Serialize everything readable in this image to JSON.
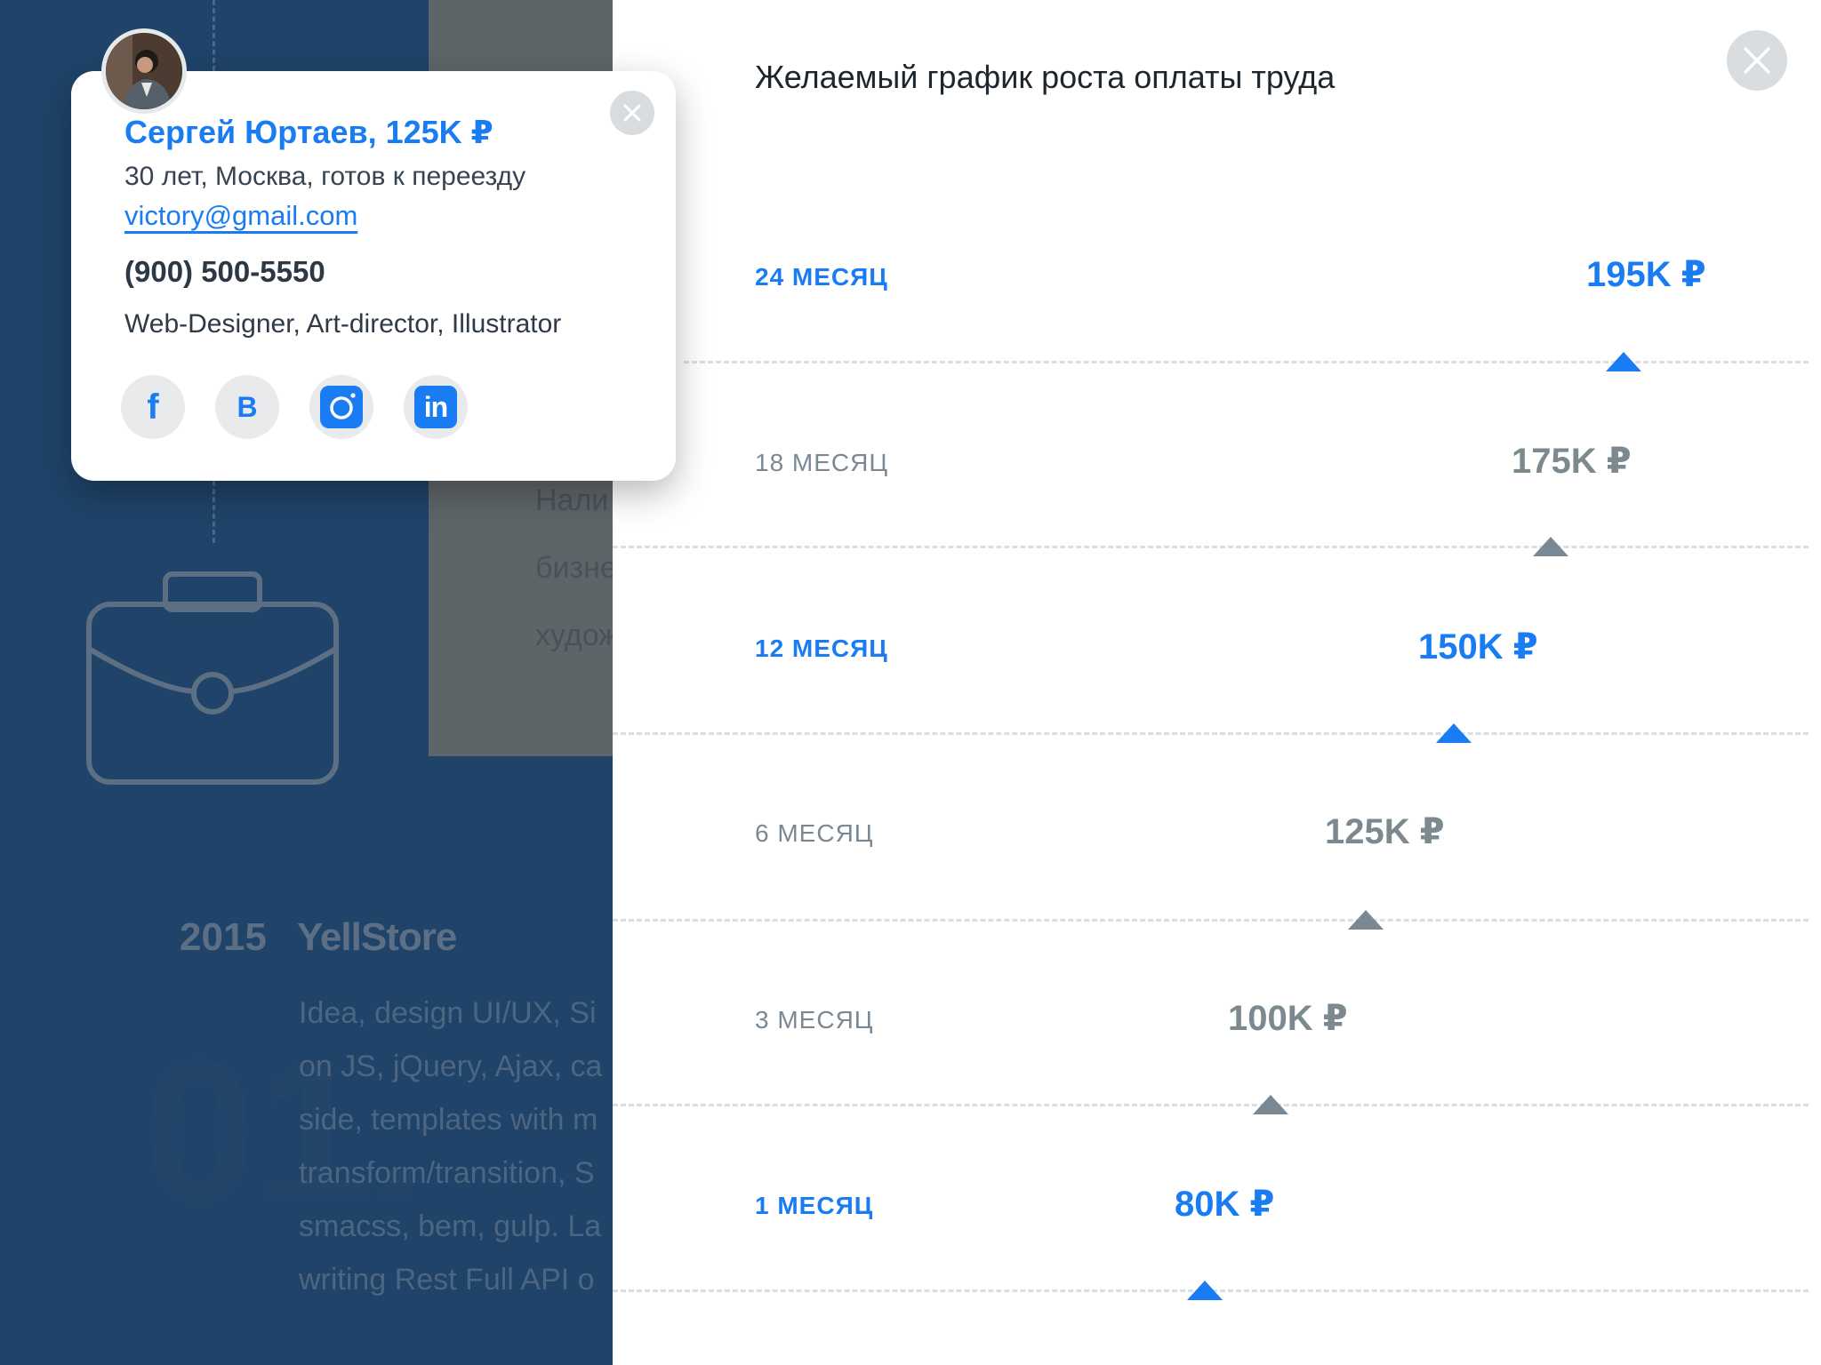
{
  "background": {
    "card_lines": [
      "Нали",
      "бизне",
      "худож"
    ],
    "year": "2015",
    "company": "YellStore",
    "ghost_text": "01.",
    "description_lines": [
      "Idea, design UI/UX, Si",
      "on JS, jQuery, Ajax, ca",
      "side, templates with m",
      "transform/transition, S",
      "smacss, bem, gulp. La",
      "writing Rest Full API o"
    ]
  },
  "contact": {
    "name_line": "Сергей Юртаев, 125K ₽",
    "info": "30 лет, Москва, готов к переезду",
    "email": "victory@gmail.com",
    "phone": "(900) 500-5550",
    "roles": "Web-Designer, Art-director, Illustrator",
    "socials": [
      {
        "name": "facebook",
        "glyph": "f"
      },
      {
        "name": "vk",
        "glyph": "B"
      },
      {
        "name": "instagram"
      },
      {
        "name": "linkedin",
        "glyph": "in"
      }
    ]
  },
  "salary_panel": {
    "title": "Желаемый график роста оплаты труда",
    "milestones": [
      {
        "label": "24 МЕСЯЦ",
        "amount": "195K ₽",
        "highlight": true
      },
      {
        "label": "18 МЕСЯЦ",
        "amount": "175K ₽",
        "highlight": false
      },
      {
        "label": "12 МЕСЯЦ",
        "amount": "150K ₽",
        "highlight": true
      },
      {
        "label": "6 МЕСЯЦ",
        "amount": "125K ₽",
        "highlight": false
      },
      {
        "label": "3 МЕСЯЦ",
        "amount": "100K ₽",
        "highlight": false
      },
      {
        "label": "1 МЕСЯЦ",
        "amount": "80K ₽",
        "highlight": true
      }
    ]
  },
  "colors": {
    "accent": "#1a7cf2",
    "muted": "#7a8893",
    "background": "#1f4369"
  }
}
